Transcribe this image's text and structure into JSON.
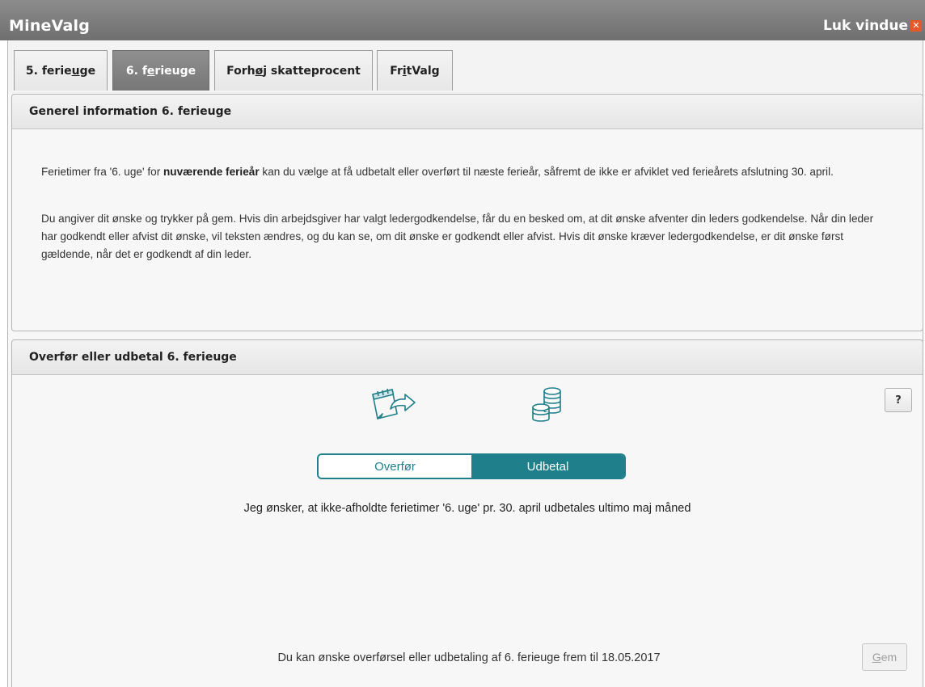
{
  "window": {
    "title": "MineValg",
    "close_label": "Luk vindue"
  },
  "tabs": [
    {
      "pre": "5. ferie",
      "ul": "u",
      "post": "ge"
    },
    {
      "pre": "6. f",
      "ul": "e",
      "post": "rieuge"
    },
    {
      "pre": "Forh",
      "ul": "ø",
      "post": "j skatteprocent"
    },
    {
      "pre": "Fr",
      "ul": "i",
      "post": "tValg"
    }
  ],
  "active_tab": "6. ferieuge",
  "info_panel": {
    "title": "Generel information 6. ferieuge",
    "p1_pre": "Ferietimer fra '6. uge' for ",
    "p1_bold": "nuværende ferieår",
    "p1_post": " kan du vælge at få udbetalt eller overført til næste ferieår, såfremt de ikke er afviklet ved ferieårets afslutning 30. april.",
    "p2": "Du angiver dit ønske og trykker på gem. Hvis din arbejdsgiver har valgt ledergodkendelse, får du en besked om, at dit ønske afventer din leders godkendelse. Når din leder har godkendt eller afvist dit ønske, vil teksten ændres, og du kan se, om dit ønske er godkendt eller afvist. Hvis dit ønske kræver ledergodkendelse, er dit ønske først gældende, når det er godkendt af din leder."
  },
  "choice_panel": {
    "title": "Overfør eller udbetal 6. ferieuge",
    "help_label": "?",
    "options": [
      "Overfør",
      "Udbetal"
    ],
    "selected": "Udbetal",
    "choice_text": "Jeg ønsker, at ikke-afholdte ferietimer '6. uge' pr. 30. april udbetales ultimo maj måned",
    "deadline_text": "Du kan ønske overførsel eller udbetaling af 6. ferieuge frem til 18.05.2017",
    "save_pre": "",
    "save_ul": "G",
    "save_post": "em",
    "save_enabled": false
  },
  "icons": {
    "transfer": "calendar-transfer-icon",
    "payout": "coins-icon"
  },
  "colors": {
    "accent": "#1f7f8a",
    "titlebar": "#7a7a7a",
    "close_x": "#e4582a"
  }
}
